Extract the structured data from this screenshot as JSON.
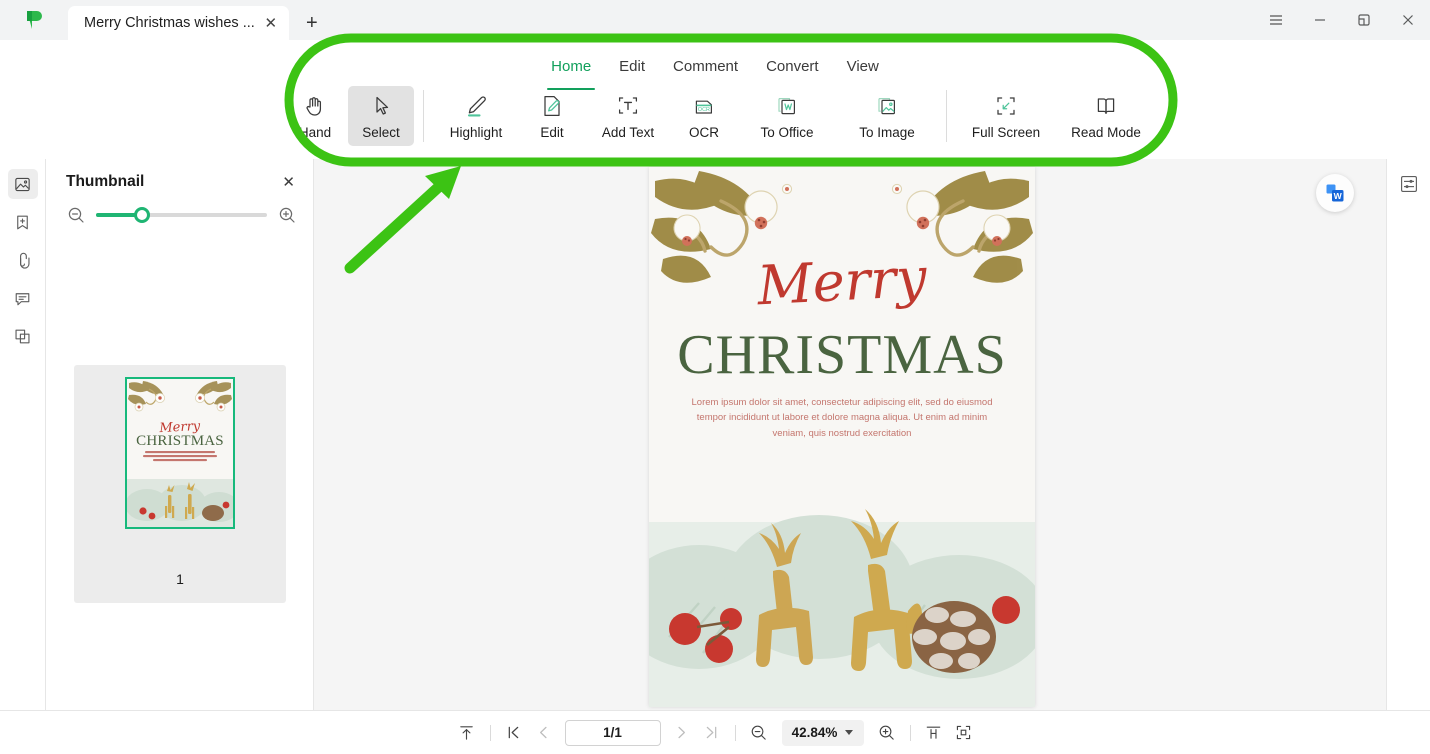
{
  "window": {
    "logo": "app-logo-green-flag",
    "tab_title": "Merry Christmas wishes ...",
    "tab_close": "✕",
    "new_tab": "+",
    "controls": [
      {
        "name": "menu",
        "icon": "hamburger-icon"
      },
      {
        "name": "minimize",
        "icon": "minimize-icon"
      },
      {
        "name": "restore",
        "icon": "restore-icon"
      },
      {
        "name": "close",
        "icon": "close-icon"
      }
    ]
  },
  "quick_access": [
    {
      "name": "main-menu",
      "icon": "hamburger-icon"
    },
    {
      "name": "more-options",
      "icon": "ellipsis-icon"
    },
    {
      "name": "save",
      "icon": "save-icon"
    },
    {
      "name": "print",
      "icon": "print-icon"
    },
    {
      "name": "undo",
      "icon": "undo-icon"
    },
    {
      "name": "redo",
      "icon": "redo-icon"
    },
    {
      "name": "share",
      "icon": "share-icon"
    },
    {
      "name": "customize",
      "icon": "chevron-down-bar-icon"
    }
  ],
  "ribbon": {
    "tabs": [
      {
        "label": "Home",
        "active": true
      },
      {
        "label": "Edit",
        "active": false
      },
      {
        "label": "Comment",
        "active": false
      },
      {
        "label": "Convert",
        "active": false
      },
      {
        "label": "View",
        "active": false
      }
    ],
    "tools": [
      {
        "label": "Hand",
        "icon": "hand-icon",
        "active": false
      },
      {
        "label": "Select",
        "icon": "cursor-arrow-icon",
        "active": true
      },
      {
        "label": "Highlight",
        "icon": "highlighter-pen-icon",
        "active": false
      },
      {
        "label": "Edit",
        "icon": "pencil-document-icon",
        "active": false
      },
      {
        "label": "Add Text",
        "icon": "add-text-icon",
        "active": false
      },
      {
        "label": "OCR",
        "icon": "ocr-icon",
        "active": false
      },
      {
        "label": "To Office",
        "icon": "to-office-word-icon",
        "active": false
      },
      {
        "label": "To Image",
        "icon": "to-image-icon",
        "active": false
      },
      {
        "label": "Full Screen",
        "icon": "full-screen-icon",
        "active": false
      },
      {
        "label": "Read Mode",
        "icon": "open-book-icon",
        "active": false
      }
    ],
    "collapse": "collapse-ribbon-icon"
  },
  "left_rail": [
    {
      "name": "thumbnail-panel",
      "icon": "thumbnail-image-icon",
      "active": true
    },
    {
      "name": "bookmark-panel",
      "icon": "bookmark-plus-icon",
      "active": false
    },
    {
      "name": "attachment-panel",
      "icon": "paperclip-icon",
      "active": false
    },
    {
      "name": "comment-panel",
      "icon": "comment-icon",
      "active": false
    },
    {
      "name": "layers-panel",
      "icon": "layers-icon",
      "active": false
    }
  ],
  "thumbnail_panel": {
    "title": "Thumbnail",
    "close": "✕",
    "zoom_out_icon": "zoom-out-icon",
    "zoom_in_icon": "zoom-in-icon",
    "slider_value": 22,
    "pages": [
      {
        "number": "1",
        "selected": true
      }
    ]
  },
  "document": {
    "script_title": "Merry",
    "main_title": "CHRISTMAS",
    "body_text": "Lorem ipsum dolor sit amet, consectetur adipiscing elit, sed do eiusmod tempor incididunt ut labore et dolore magna aliqua. Ut enim ad minim veniam, quis nostrud exercitation",
    "convert_badge": "word-convert-badge-icon"
  },
  "right_rail": [
    {
      "name": "properties-panel",
      "icon": "properties-panel-icon"
    }
  ],
  "status_bar": {
    "fit_top_icon": "scroll-to-top-icon",
    "first_page_icon": "first-page-icon",
    "prev_page_icon": "previous-page-icon",
    "page_value": "1/1",
    "next_page_icon": "next-page-icon",
    "last_page_icon": "last-page-icon",
    "zoom_out_icon": "zoom-out-icon",
    "zoom_value": "42.84%",
    "zoom_in_icon": "zoom-in-icon",
    "fit_width_icon": "fit-width-icon",
    "fit_page_icon": "fit-page-icon"
  },
  "annotation": {
    "highlight_color": "#3cc314",
    "shapes": [
      "rounded-rectangle-outline",
      "arrow-pointing-up-right"
    ]
  },
  "colors": {
    "accent_green": "#12a05c",
    "slider_green": "#1fb573",
    "annotation_green": "#3cc314",
    "title_red": "#c0392f",
    "title_green": "#4a6440"
  }
}
